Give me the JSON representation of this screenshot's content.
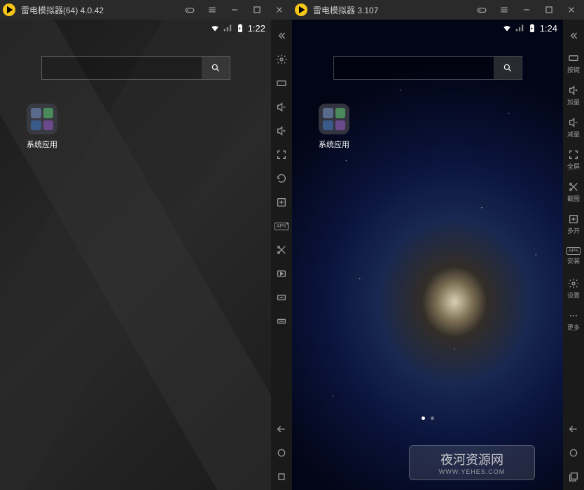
{
  "emulator1": {
    "title": "雷电模拟器(64) 4.0.42",
    "status": {
      "time": "1:22"
    },
    "app_label": "系统应用"
  },
  "emulator2": {
    "title": "雷电模拟器 3.107",
    "status": {
      "time": "1:24"
    },
    "app_label": "系统应用",
    "sidebar": {
      "keymap": "按键",
      "volup": "加量",
      "voldown": "减量",
      "fullscreen": "全屏",
      "screenshot": "截图",
      "multi": "多开",
      "install": "安装",
      "settings": "设置",
      "more": "更多"
    }
  },
  "watermark": {
    "title": "夜河资源网",
    "url": "WWW.YEHES.COM"
  },
  "icons": {
    "apk_text": "APK"
  }
}
